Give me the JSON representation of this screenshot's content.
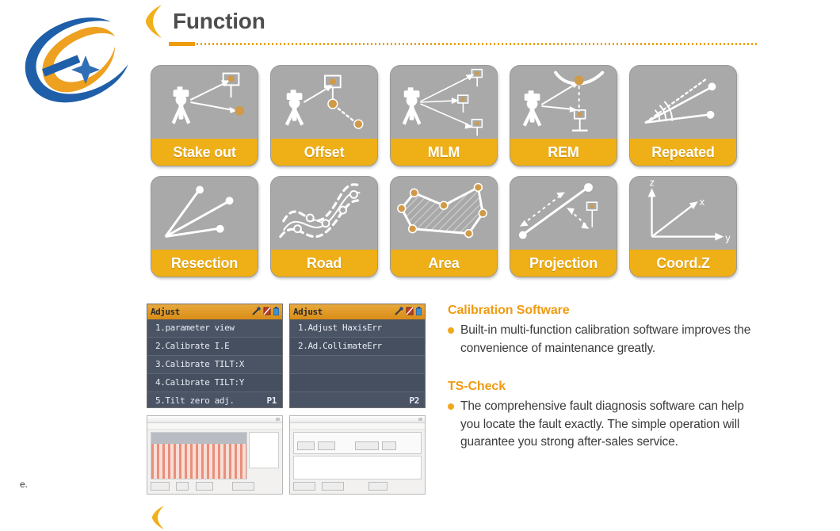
{
  "header": {
    "title": "Function",
    "bracket_icon": "bracket-marker-icon",
    "accent_color": "#ef9b12",
    "rule_color": "#eda21a"
  },
  "logo": {
    "name": "company-logo",
    "blue": "#1f5fa9",
    "orange": "#eea020",
    "star": "#2f6fb5"
  },
  "functions": {
    "rows": [
      [
        {
          "label": "Stake out",
          "icon": "stake-out-icon"
        },
        {
          "label": "Offset",
          "icon": "offset-icon"
        },
        {
          "label": "MLM",
          "icon": "mlm-icon"
        },
        {
          "label": "REM",
          "icon": "rem-icon"
        },
        {
          "label": "Repeated",
          "icon": "repeated-icon"
        }
      ],
      [
        {
          "label": "Resection",
          "icon": "resection-icon"
        },
        {
          "label": "Road",
          "icon": "road-icon"
        },
        {
          "label": "Area",
          "icon": "area-icon"
        },
        {
          "label": "Projection",
          "icon": "projection-icon"
        },
        {
          "label": "Coord.Z",
          "icon": "coord-z-icon"
        }
      ]
    ],
    "card_bg": "#a9a9a9",
    "caption_bg": "#efaf16"
  },
  "coord_axes": {
    "z": "z",
    "x": "x",
    "y": "y"
  },
  "device_screens": [
    {
      "title": "Adjust",
      "page": "P1",
      "status_icons": [
        "pen-icon",
        "battery-low-icon",
        "battery-icon"
      ],
      "items": [
        "1.parameter view",
        "2.Calibrate I.E",
        "3.Calibrate TILT:X",
        "4.Calibrate TILT:Y",
        "5.Tilt zero adj."
      ]
    },
    {
      "title": "Adjust",
      "page": "P2",
      "status_icons": [
        "pen-icon",
        "battery-low-icon",
        "battery-icon"
      ],
      "items": [
        "1.Adjust HaxisErr",
        "2.Ad.CollimateErr",
        "",
        "",
        ""
      ]
    }
  ],
  "blocks": [
    {
      "title": "Calibration Software",
      "bullet": "Built-in multi-function calibration software improves the convenience of maintenance greatly."
    },
    {
      "title": "TS-Check",
      "bullet": "The comprehensive fault diagnosis software can help you locate the fault exactly. The simple operation will guarantee you strong after-sales service."
    }
  ],
  "footer": {
    "page_mark": "e."
  }
}
